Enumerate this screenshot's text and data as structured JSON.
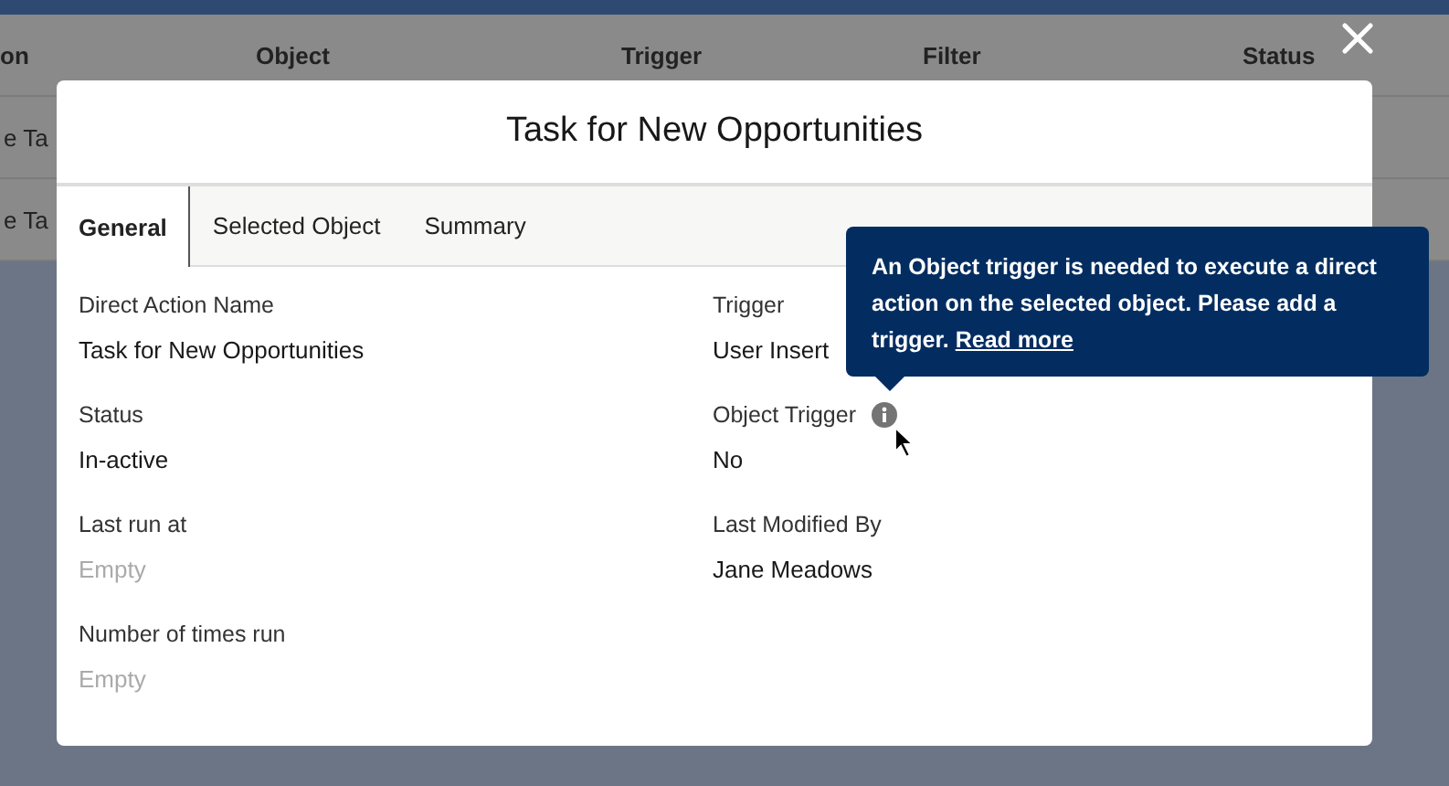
{
  "background_table": {
    "columns": [
      "on",
      "Object",
      "Trigger",
      "Filter",
      "Status"
    ],
    "rows": [
      {
        "column_1": "e Ta"
      },
      {
        "column_1": "e Ta"
      }
    ]
  },
  "modal": {
    "title": "Task for New Opportunities",
    "tabs": [
      {
        "label": "General",
        "selected": true
      },
      {
        "label": "Selected Object",
        "selected": false
      },
      {
        "label": "Summary",
        "selected": false
      }
    ],
    "left_fields": [
      {
        "label": "Direct Action Name",
        "value": "Task for New Opportunities",
        "empty": false
      },
      {
        "label": "Status",
        "value": "In-active",
        "empty": false
      },
      {
        "label": "Last run at",
        "value": "Empty",
        "empty": true
      },
      {
        "label": "Number of times run",
        "value": "Empty",
        "empty": true
      }
    ],
    "right_fields": [
      {
        "label": "Trigger",
        "value": "User Insert",
        "empty": false,
        "info": false
      },
      {
        "label": "Object Trigger",
        "value": "No",
        "empty": false,
        "info": true
      },
      {
        "label": "Last Modified By",
        "value": "Jane Meadows",
        "empty": false,
        "info": false
      }
    ]
  },
  "tooltip": {
    "text": "An Object trigger is needed to execute a direct action on the selected object. Please add a trigger.",
    "link": "Read more"
  }
}
